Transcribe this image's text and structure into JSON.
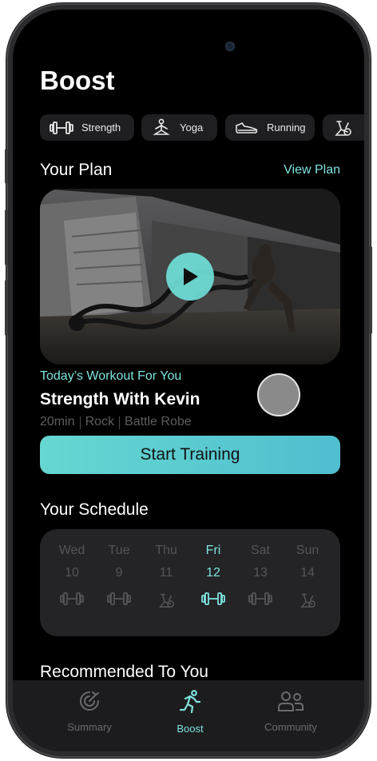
{
  "app": {
    "title": "Boost"
  },
  "categories": [
    {
      "label": "Strength",
      "icon": "dumbbell-icon"
    },
    {
      "label": "Yoga",
      "icon": "yoga-icon"
    },
    {
      "label": "Running",
      "icon": "shoe-icon"
    },
    {
      "label": "",
      "icon": "bike-icon"
    }
  ],
  "plan": {
    "heading": "Your Plan",
    "view_link": "View Plan",
    "subtitle": "Today’s Workout For You",
    "workout_name": "Strength With Kevin",
    "meta": [
      "20min",
      "Rock",
      "Battle Robe"
    ],
    "start_label": "Start Training"
  },
  "schedule": {
    "heading": "Your Schedule",
    "days": [
      {
        "name": "Wed",
        "num": "10",
        "icon": "dumbbell-icon",
        "active": false
      },
      {
        "name": "Tue",
        "num": "9",
        "icon": "dumbbell-icon",
        "active": false
      },
      {
        "name": "Thu",
        "num": "11",
        "icon": "bike-icon",
        "active": false
      },
      {
        "name": "Fri",
        "num": "12",
        "icon": "dumbbell-icon",
        "active": true
      },
      {
        "name": "Sat",
        "num": "13",
        "icon": "dumbbell-icon",
        "active": false
      },
      {
        "name": "Sun",
        "num": "14",
        "icon": "bike-icon",
        "active": false
      }
    ]
  },
  "recommended": {
    "heading": "Recommended To You"
  },
  "tabbar": {
    "tabs": [
      {
        "label": "Summary",
        "icon": "summary-icon",
        "active": false
      },
      {
        "label": "Boost",
        "icon": "runner-icon",
        "active": true
      },
      {
        "label": "Community",
        "icon": "people-icon",
        "active": false
      }
    ]
  },
  "colors": {
    "accent": "#7fe4de",
    "background": "#000000",
    "card": "#242426"
  }
}
